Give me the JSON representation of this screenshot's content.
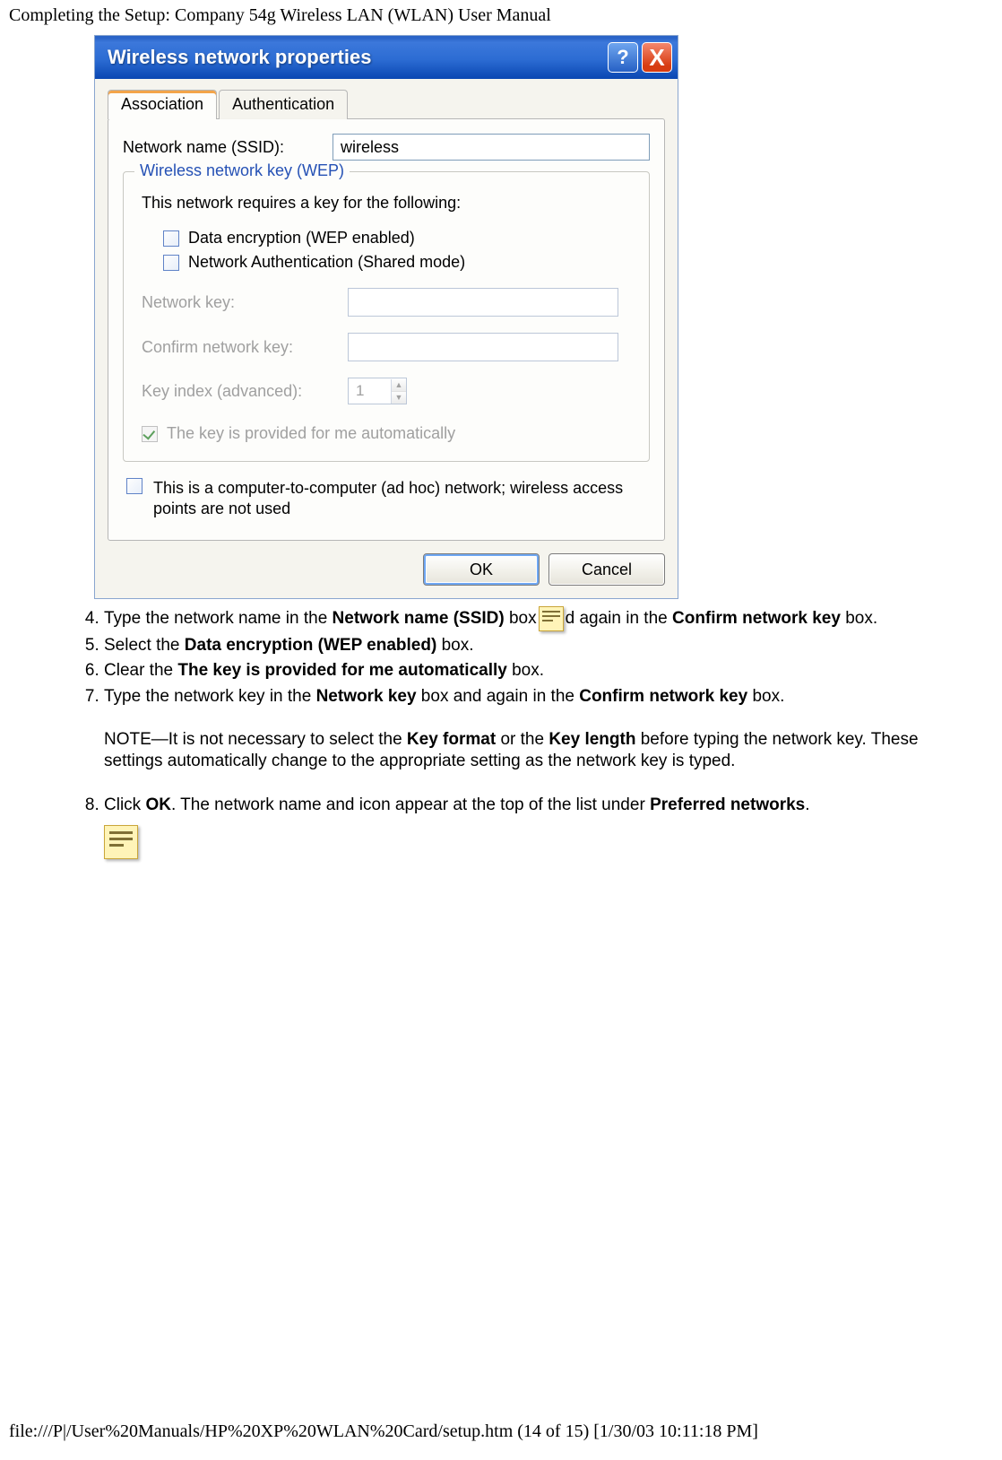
{
  "page": {
    "header": "Completing the Setup: Company 54g Wireless LAN (WLAN) User Manual",
    "footer": "file:///P|/User%20Manuals/HP%20XP%20WLAN%20Card/setup.htm (14 of 15) [1/30/03 10:11:18 PM]"
  },
  "dialog": {
    "title": "Wireless network properties",
    "help_glyph": "?",
    "close_glyph": "X",
    "tabs": {
      "association": "Association",
      "authentication": "Authentication",
      "selected_index": 0
    },
    "ssid_label": "Network name (SSID):",
    "ssid_value": "wireless",
    "fieldset_legend": "Wireless network key (WEP)",
    "requires_text": "This network requires a key for the following:",
    "check_data_encryption": "Data encryption (WEP enabled)",
    "check_network_auth": "Network Authentication (Shared mode)",
    "network_key_label": "Network key:",
    "confirm_key_label": "Confirm network key:",
    "key_index_label": "Key index (advanced):",
    "key_index_value": "1",
    "auto_key_label": "The key is provided for me automatically",
    "adhoc_text": "This is a computer-to-computer (ad hoc) network; wireless access points are not used",
    "ok_label": "OK",
    "cancel_label": "Cancel"
  },
  "instructions": {
    "start": 4,
    "items": [
      {
        "pre": "Type the network name in the ",
        "b1": "Network name (SSID)",
        "mid": " box",
        "icon": true,
        "post1": "d again in the ",
        "b2": "Confirm network key",
        "post2": " box."
      },
      {
        "pre": "Select the ",
        "b1": "Data encryption (WEP enabled)",
        "post": " box."
      },
      {
        "pre": "Clear the ",
        "b1": "The key is provided for me automatically",
        "post": " box."
      },
      {
        "pre": "Type the network key in the ",
        "b1": "Network key",
        "mid": " box and again in the ",
        "b2": "Confirm network key",
        "post": " box."
      }
    ],
    "note_pre": "NOTE—It is not necessary to select the ",
    "note_b1": "Key format",
    "note_mid1": " or the ",
    "note_b2": "Key length",
    "note_post": " before typing the network key. These settings automatically change to the appropriate setting as the network key is typed.",
    "item8_pre": "Click ",
    "item8_b1": "OK",
    "item8_mid": ". The network name and icon appear at the top of the list under ",
    "item8_b2": "Preferred networks",
    "item8_post": "."
  }
}
